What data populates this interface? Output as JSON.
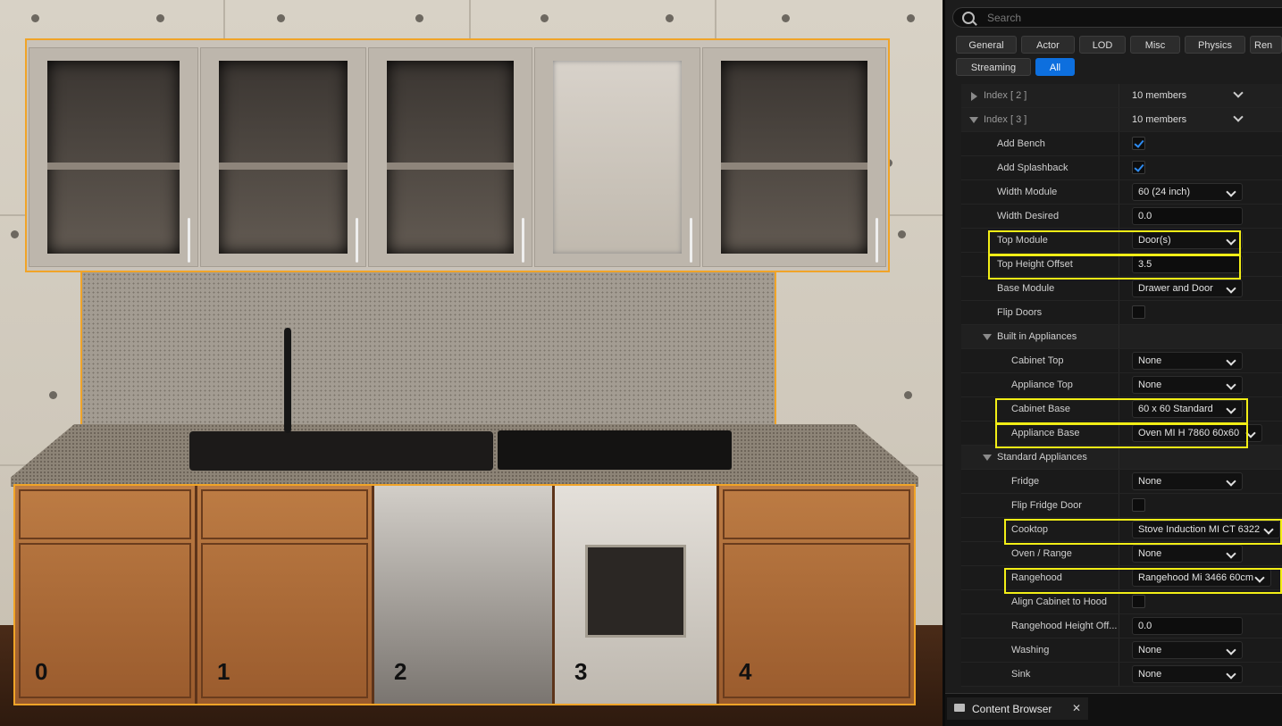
{
  "viewport": {
    "cabinet_numbers": [
      "0",
      "1",
      "2",
      "3",
      "4"
    ]
  },
  "details": {
    "search_placeholder": "Search",
    "filter_tabs": [
      {
        "label": "General"
      },
      {
        "label": "Actor"
      },
      {
        "label": "LOD"
      },
      {
        "label": "Misc"
      },
      {
        "label": "Physics"
      },
      {
        "label": "Ren"
      },
      {
        "label": "Streaming"
      },
      {
        "label": "All",
        "active": true
      }
    ],
    "rows": {
      "index2": {
        "label": "Index [ 2 ]",
        "value": "10 members"
      },
      "index3": {
        "label": "Index [ 3 ]",
        "value": "10 members"
      },
      "add_bench": {
        "label": "Add Bench",
        "checked": true
      },
      "add_splashback": {
        "label": "Add Splashback",
        "checked": true
      },
      "width_module": {
        "label": "Width Module",
        "value": "60 (24 inch)"
      },
      "width_desired": {
        "label": "Width Desired",
        "value": "0.0"
      },
      "top_module": {
        "label": "Top Module",
        "value": "Door(s)"
      },
      "top_height_offset": {
        "label": "Top Height Offset",
        "value": "3.5"
      },
      "base_module": {
        "label": "Base Module",
        "value": "Drawer and Door"
      },
      "flip_doors": {
        "label": "Flip Doors",
        "checked": false
      },
      "built_in_appliances": {
        "label": "Built in Appliances"
      },
      "cabinet_top": {
        "label": "Cabinet Top",
        "value": "None"
      },
      "appliance_top": {
        "label": "Appliance Top",
        "value": "None"
      },
      "cabinet_base": {
        "label": "Cabinet Base",
        "value": "60 x 60 Standard"
      },
      "appliance_base": {
        "label": "Appliance Base",
        "value": "Oven MI H 7860 60x60"
      },
      "standard_appliances": {
        "label": "Standard Appliances"
      },
      "fridge": {
        "label": "Fridge",
        "value": "None"
      },
      "flip_fridge_door": {
        "label": "Flip Fridge Door",
        "checked": false
      },
      "cooktop": {
        "label": "Cooktop",
        "value": "Stove Induction MI CT 6322"
      },
      "oven_range": {
        "label": "Oven / Range",
        "value": "None"
      },
      "rangehood": {
        "label": "Rangehood",
        "value": "Rangehood Mi 3466 60cm"
      },
      "align_cabinet_to_hood": {
        "label": "Align Cabinet to Hood",
        "checked": false
      },
      "rangehood_height_offset": {
        "label": "Rangehood Height Off...",
        "value": "0.0"
      },
      "washing": {
        "label": "Washing",
        "value": "None"
      },
      "sink": {
        "label": "Sink",
        "value": "None"
      }
    },
    "content_browser_tab": "Content Browser",
    "close_glyph": "✕"
  },
  "colors": {
    "selection_outline": "#f0a428",
    "highlight_box": "#f2ee16",
    "active_tab": "#0d6fde"
  }
}
